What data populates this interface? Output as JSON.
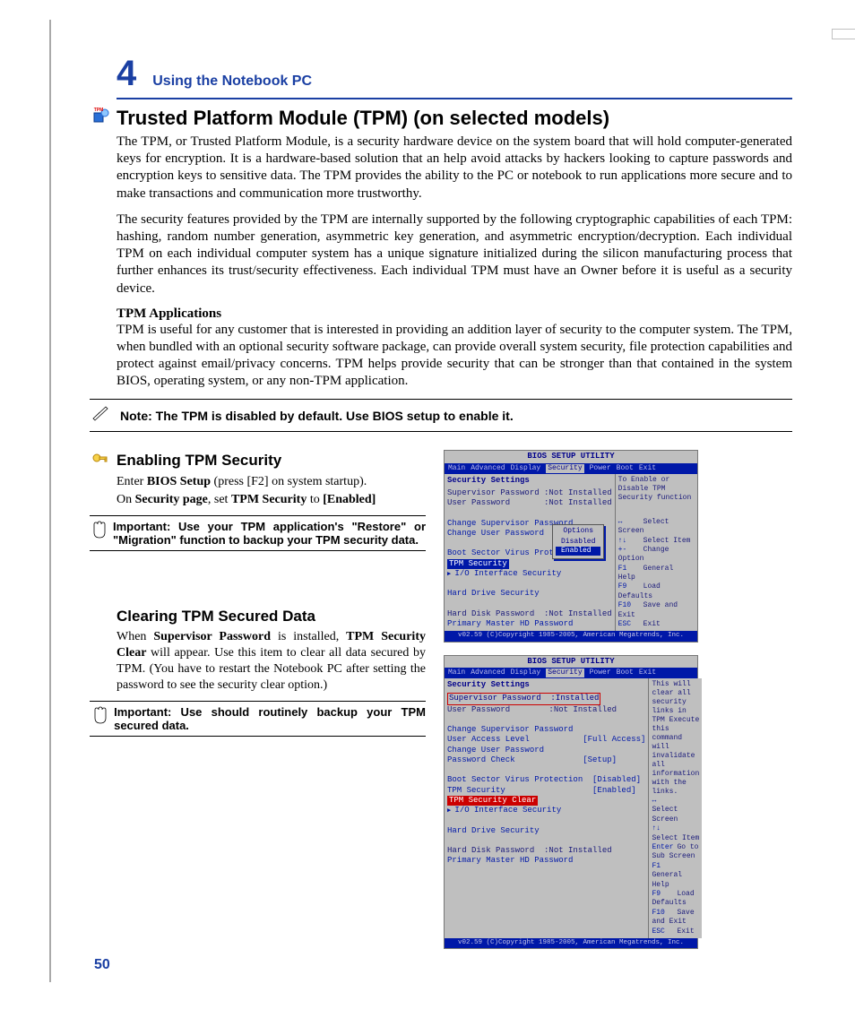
{
  "chapter": {
    "number": "4",
    "title": "Using the Notebook PC"
  },
  "section": {
    "title": "Trusted Platform Module (TPM) (on selected models)",
    "para1": "The TPM, or Trusted Platform Module, is a security hardware device on the system board that will hold computer-generated keys for encryption. It is a hardware-based solution that an help avoid attacks by hackers looking to capture passwords and encryption keys to sensitive data. The TPM provides the ability to the PC or notebook to run applications more secure and to make transactions and communication more trustworthy.",
    "para2": "The security features provided by the TPM are internally supported by the following cryptographic capabilities of each TPM: hashing, random number generation, asymmetric key generation, and asymmetric encryption/decryption. Each individual TPM on each individual computer system has a unique signature initialized during the silicon manufacturing process that further enhances its trust/security effectiveness. Each individual TPM must have an Owner before it is useful as a security device.",
    "apps_head": "TPM Applications",
    "apps_body": "TPM is useful for any customer that is interested in providing an addition layer of security to the computer system. The TPM, when bundled with an optional security software package, can provide overall system security, file protection capabilities and protect against email/privacy concerns. TPM helps provide security that can be stronger than that contained in the system BIOS, operating system, or any non-TPM application."
  },
  "note": {
    "text": "Note: The TPM is disabled by default. Use BIOS setup to enable it."
  },
  "enable": {
    "title": "Enabling TPM Security",
    "line1a": "Enter ",
    "line1b": "BIOS Setup",
    "line1c": " (press [F2] on system startup).",
    "line2a": "On ",
    "line2b": "Security page",
    "line2c": ", set ",
    "line2d": "TPM Security",
    "line2e": " to ",
    "line2f": "[Enabled]",
    "important": "Important: Use your TPM application's \"Restore\" or \"Migration\" function to backup your TPM security data."
  },
  "clear": {
    "title": "Clearing TPM Secured Data",
    "body_a": "When ",
    "body_b": "Supervisor Password",
    "body_c": " is installed, ",
    "body_d": "TPM Security Clear",
    "body_e": " will appear. Use this item to clear all data secured by TPM. (You have to restart the Notebook PC after setting the password to see the security clear option.)",
    "important": "Important: Use should routinely backup your TPM secured data."
  },
  "bios": {
    "title": "BIOS SETUP UTILITY",
    "menu": [
      "Main",
      "Advanced",
      "Display",
      "Security",
      "Power",
      "Boot",
      "Exit"
    ],
    "footer": "v02.59 (C)Copyright 1985-2005, American Megatrends, Inc.",
    "help_nav": [
      {
        "k": "↔",
        "t": "Select Screen"
      },
      {
        "k": "↑↓",
        "t": "Select Item"
      },
      {
        "k": "+-",
        "t": "Change Option"
      },
      {
        "k": "F1",
        "t": "General Help"
      },
      {
        "k": "F9",
        "t": "Load Defaults"
      },
      {
        "k": "F10",
        "t": "Save and Exit"
      },
      {
        "k": "ESC",
        "t": "Exit"
      }
    ],
    "help_nav2": [
      {
        "k": "↔",
        "t": "Select Screen"
      },
      {
        "k": "↑↓",
        "t": "Select Item"
      },
      {
        "k": "Enter",
        "t": "Go to Sub Screen"
      },
      {
        "k": "F1",
        "t": "General Help"
      },
      {
        "k": "F9",
        "t": "Load Defaults"
      },
      {
        "k": "F10",
        "t": "Save and Exit"
      },
      {
        "k": "ESC",
        "t": "Exit"
      }
    ],
    "shot1": {
      "help_top": "To Enable or Disable TPM Security function",
      "header": "Security Settings",
      "rows": [
        "Supervisor Password :Not Installed",
        "User Password       :Not Installed",
        "",
        "Change Supervisor Password",
        "Change User Password",
        "",
        "Boot Sector Virus Protectio",
        "",
        "",
        "",
        "Hard Drive Security",
        "",
        "Hard Disk Password  :Not Installed",
        "Primary Master HD Password"
      ],
      "tpm_label": "TPM Security",
      "io_label": "I/O Interface Security",
      "popup_title": "Options",
      "popup_opts": [
        "Disabled",
        "Enabled"
      ],
      "popup_active": 1
    },
    "shot2": {
      "help_top": "This will clear all security links in TPM Execute this command will invalidate all information with the links.",
      "header": "Security Settings",
      "supervisor": "Supervisor Password  :Installed",
      "rows_top": [
        "User Password        :Not Installed",
        "",
        "Change Supervisor Password",
        "User Access Level           [Full Access]",
        "Change User Password",
        "Password Check              [Setup]",
        "",
        "Boot Sector Virus Protection  [Disabled]",
        "TPM Security                  [Enabled]"
      ],
      "clear_label": "TPM Security Clear",
      "rows_bot": [
        "",
        "Hard Drive Security",
        "",
        "Hard Disk Password  :Not Installed",
        "Primary Master HD Password"
      ],
      "io_label": "I/O Interface Security"
    }
  },
  "page_number": "50"
}
